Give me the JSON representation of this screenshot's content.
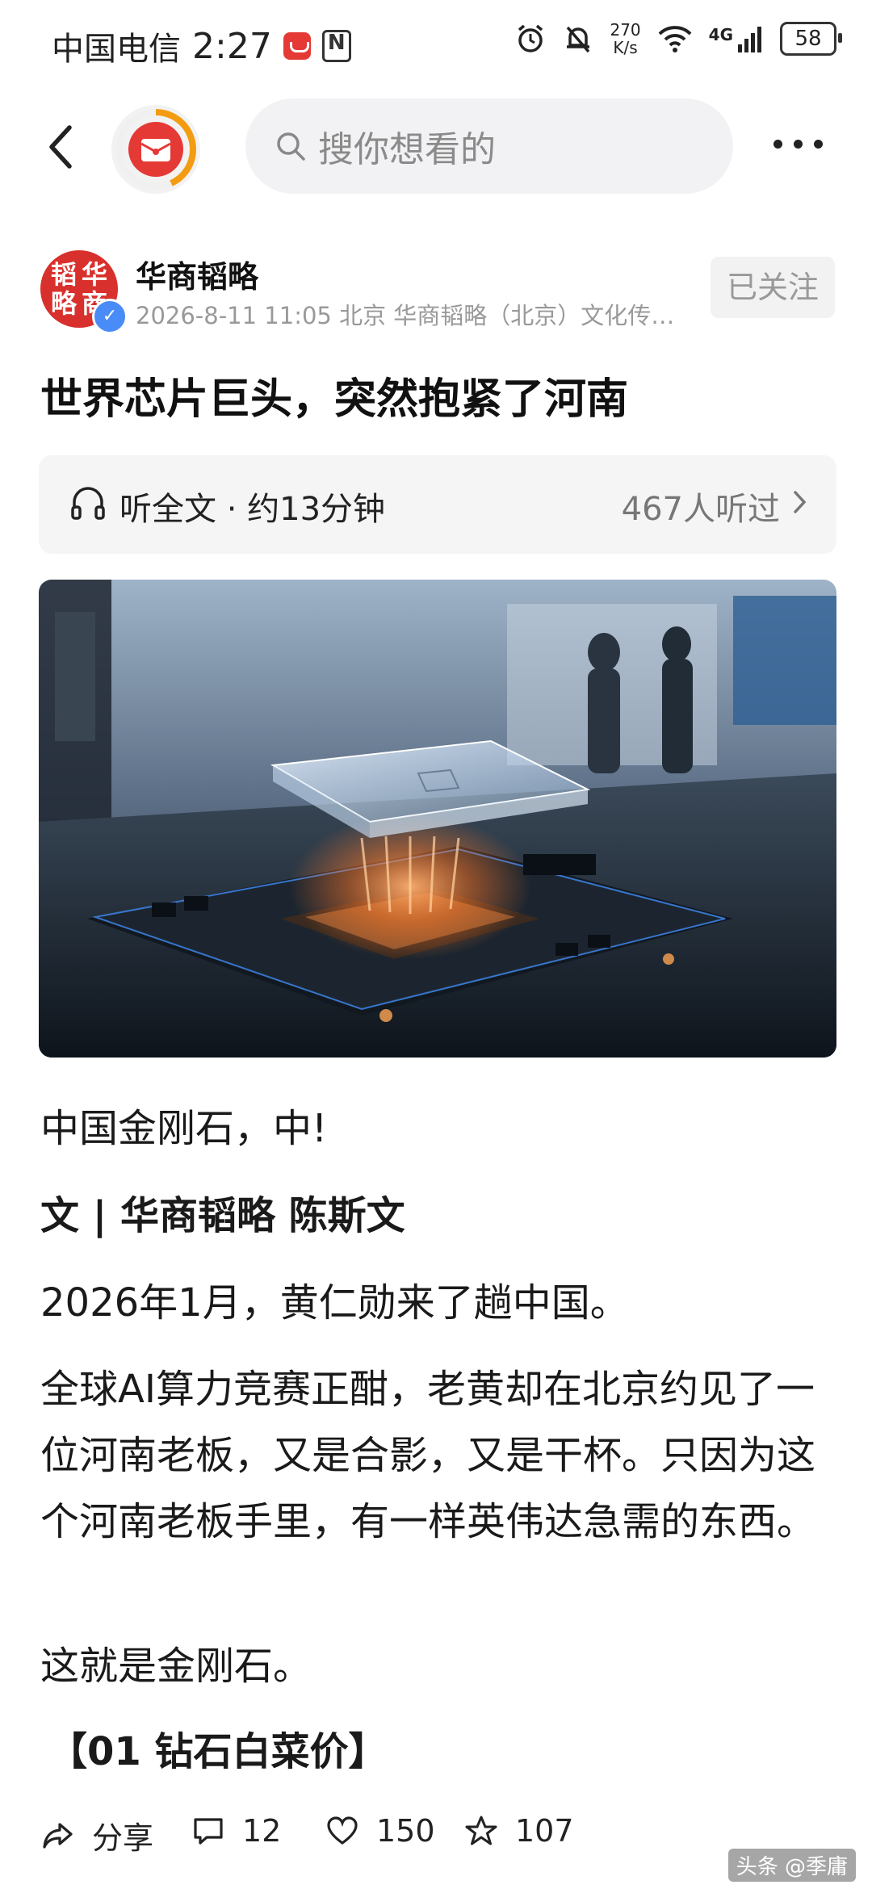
{
  "status_bar": {
    "carrier": "中国电信",
    "time": "2:27",
    "net_speed_value": "270",
    "net_speed_unit": "K/s",
    "network": "4G",
    "battery": "58"
  },
  "nav": {
    "search_placeholder": "搜你想看的"
  },
  "author": {
    "name": "华商韬略",
    "avatar_chars": [
      "韬",
      "华",
      "略",
      "商"
    ],
    "meta": "2026-8-11  11:05  北京  华商韬略（北京）文化传…",
    "follow_label": "已关注"
  },
  "article": {
    "title": "世界芯片巨头，突然抱紧了河南",
    "listen_label": "听全文 · 约13分钟",
    "listen_count": "467人听过",
    "paragraphs": {
      "p1": "中国金刚石，中!",
      "p2": "文 | 华商韬略 陈斯文",
      "p3": "2026年1月，黄仁勋来了趟中国。",
      "p4": "全球AI算力竞赛正酣，老黄却在北京约见了一位河南老板，又是合影，又是干杯。只因为这个河南老板手里，有一样英伟达急需的东西。",
      "p5": "这就是金刚石。",
      "p6": "【01 钻石白菜价】"
    }
  },
  "actions": {
    "share_label": "分享",
    "comment_count": "12",
    "like_count": "150",
    "favorite_count": "107"
  },
  "watermark": "头条 @季庸",
  "colors": {
    "brand_red": "#e53935",
    "verify_blue": "#4a8cf7",
    "muted_text": "#999999"
  }
}
